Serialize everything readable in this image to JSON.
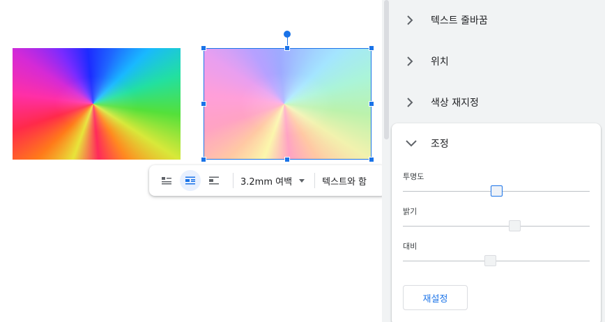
{
  "toolbar": {
    "margin_value": "3.2mm 여백",
    "wrap_option": "텍스트와 함"
  },
  "panel": {
    "sections": [
      {
        "label": "텍스트 줄바꿈",
        "expanded": false
      },
      {
        "label": "위치",
        "expanded": false
      },
      {
        "label": "색상 재지정",
        "expanded": false
      }
    ],
    "adjust": {
      "title": "조정",
      "expanded": true,
      "sliders": [
        {
          "label": "투명도",
          "value": 0.5,
          "focused": true
        },
        {
          "label": "밝기",
          "value": 0.6
        },
        {
          "label": "대비",
          "value": 0.47
        }
      ],
      "reset_label": "재설정"
    }
  },
  "colors": {
    "accent": "#1a73e8",
    "panel_bg": "#f1f3f4",
    "active_chip": "#e8f0fe"
  }
}
